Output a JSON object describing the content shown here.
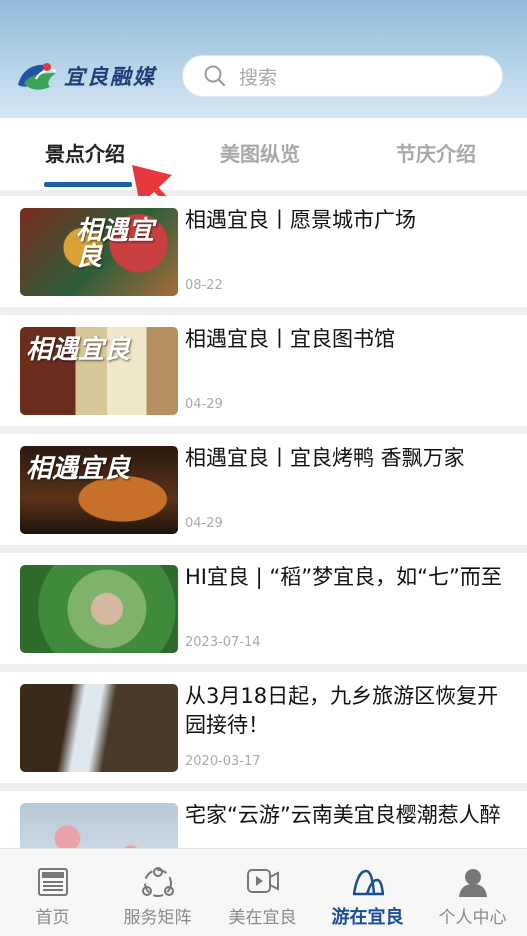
{
  "header": {
    "logo_text": "宜良融媒",
    "search_placeholder": "搜索"
  },
  "tabs": [
    {
      "label": "景点介绍",
      "active": true
    },
    {
      "label": "美图纵览",
      "active": false
    },
    {
      "label": "节庆介绍",
      "active": false
    }
  ],
  "articles": [
    {
      "title": "相遇宜良丨愿景城市广场",
      "date": "08-22",
      "thumb_tag": "相遇宜良"
    },
    {
      "title": "相遇宜良丨宜良图书馆",
      "date": "04-29",
      "thumb_tag": "相遇宜良"
    },
    {
      "title": "相遇宜良丨宜良烤鸭 香飘万家",
      "date": "04-29",
      "thumb_tag": "相遇宜良"
    },
    {
      "title": "HI宜良 | “稻”梦宜良，如“七”而至",
      "date": "2023-07-14",
      "thumb_tag": ""
    },
    {
      "title": "从3月18日起，九乡旅游区恢复开园接待！",
      "date": "2020-03-17",
      "thumb_tag": ""
    },
    {
      "title": "宅家“云游”云南美宜良樱潮惹人醉",
      "date": "",
      "thumb_tag": ""
    }
  ],
  "bottom_nav": [
    {
      "label": "首页",
      "icon": "news-icon",
      "active": false
    },
    {
      "label": "服务矩阵",
      "icon": "matrix-icon",
      "active": false
    },
    {
      "label": "美在宜良",
      "icon": "video-icon",
      "active": false
    },
    {
      "label": "游在宜良",
      "icon": "mountain-icon",
      "active": true
    },
    {
      "label": "个人中心",
      "icon": "user-icon",
      "active": false
    }
  ],
  "colors": {
    "accent": "#1a5fa8",
    "active_nav": "#1b4f93",
    "arrow": "#e8383d"
  }
}
